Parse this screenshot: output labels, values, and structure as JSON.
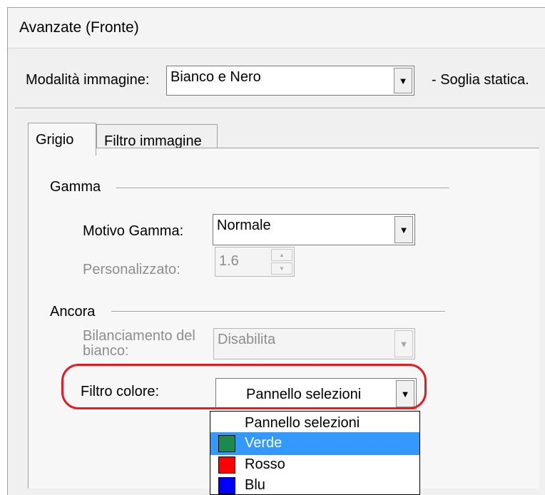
{
  "window": {
    "title": "Avanzate (Fronte)"
  },
  "image_mode": {
    "label": "Modalità immagine:",
    "value": "Bianco e Nero",
    "note": "- Soglia statica."
  },
  "tabs": [
    {
      "label": "Grigio",
      "active": true
    },
    {
      "label": "Filtro immagine",
      "active": false
    }
  ],
  "gamma": {
    "group_label": "Gamma",
    "pattern_label": "Motivo Gamma:",
    "pattern_value": "Normale",
    "custom_label": "Personalizzato:",
    "custom_value": "1.6"
  },
  "ancora": {
    "group_label": "Ancora",
    "white_balance_label_line1": "Bilanciamento del",
    "white_balance_label_line2": "bianco:",
    "white_balance_value": "Disabilita",
    "color_filter_label": "Filtro colore:",
    "color_filter_value": "Pannello selezioni"
  },
  "dropdown": {
    "options": [
      {
        "label": "Pannello selezioni",
        "swatch": null,
        "selected": false
      },
      {
        "label": "Verde",
        "swatch": "#1c8a4a",
        "selected": true
      },
      {
        "label": "Rosso",
        "swatch": "#ff0000",
        "selected": false
      },
      {
        "label": "Blu",
        "swatch": "#0000ff",
        "selected": false
      }
    ]
  },
  "colors": {
    "highlight_ring": "#e31b23",
    "selection": "#3399ff"
  },
  "icons": {
    "combo_arrow": "chevron-down-icon",
    "spin_up": "arrow-up-icon",
    "spin_down": "arrow-down-icon"
  }
}
